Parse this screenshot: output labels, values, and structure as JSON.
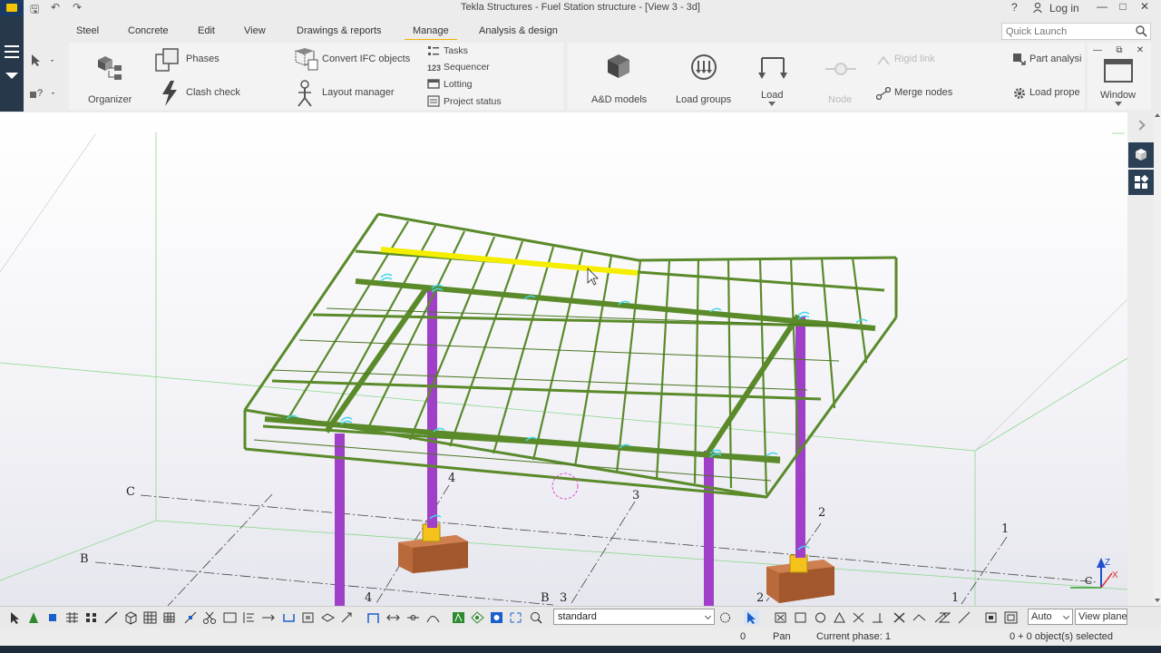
{
  "window": {
    "title": "Tekla Structures - Fuel Station structure  - [View 3 - 3d]",
    "help": "?",
    "login": "Log in"
  },
  "menu": {
    "tabs": [
      "Steel",
      "Concrete",
      "Edit",
      "View",
      "Drawings & reports",
      "Manage",
      "Analysis & design"
    ],
    "active_tab": "Manage",
    "quick_launch_placeholder": "Quick Launch"
  },
  "ribbon": {
    "organizer": "Organizer",
    "phases": "Phases",
    "clash_check": "Clash check",
    "convert_ifc": "Convert IFC objects",
    "layout_manager": "Layout manager",
    "tasks": "Tasks",
    "sequencer": "Sequencer",
    "lotting": "Lotting",
    "project_status": "Project status",
    "ad_models": "A&D models",
    "load_groups": "Load groups",
    "load": "Load",
    "node": "Node",
    "rigid_link": "Rigid link",
    "merge_nodes": "Merge nodes",
    "part_analysis": "Part analysi",
    "load_properties": "Load prope",
    "window": "Window"
  },
  "viewport": {
    "grid_labels": {
      "C_left": "C",
      "B_left": "B",
      "four_top": "4",
      "four_bottom": "4",
      "B_bottom": "B",
      "three_bottom": "3",
      "three_top": "3",
      "two_top": "2",
      "two_bottom": "2",
      "one_right": "1",
      "one_bottom": "1"
    },
    "axis_labels": {
      "z": "Z",
      "x": "X",
      "corner": "C"
    },
    "colors": {
      "steel_green": "#5a8a2a",
      "highlight_yellow": "#f5ee00",
      "column_purple": "#a040c8",
      "footing_brown": "#b86a3a",
      "baseplate_yellow": "#f4c21a",
      "grid_green": "#8cd88c",
      "cyan_bolts": "#40d8e8"
    }
  },
  "bottom_toolbar": {
    "selection_filter": "standard",
    "zoom_mode": "Auto",
    "view_plane": "View plane"
  },
  "status": {
    "coord": "0",
    "mode": "Pan",
    "phase": "Current phase: 1",
    "selection": "0 + 0 object(s) selected"
  }
}
